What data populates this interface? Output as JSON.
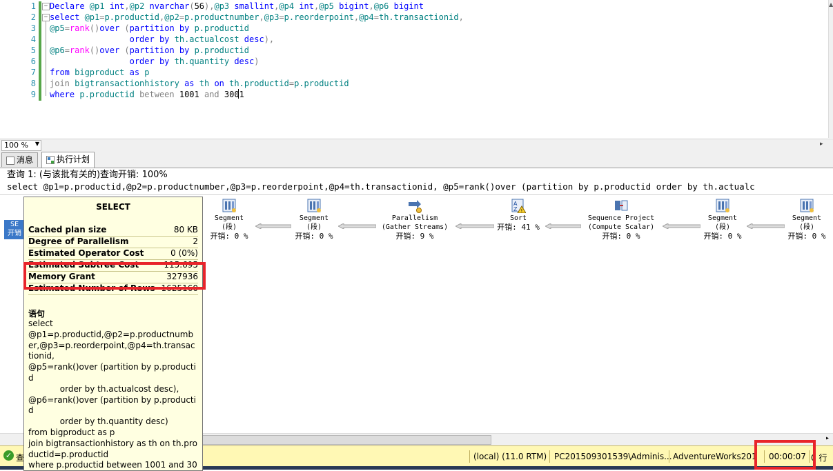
{
  "editor": {
    "line_numbers": [
      "1",
      "2",
      "3",
      "4",
      "5",
      "6",
      "7",
      "8",
      "9"
    ],
    "lines": [
      [
        {
          "c": "kw",
          "t": "Declare "
        },
        {
          "c": "tx",
          "t": "@p1 "
        },
        {
          "c": "kw",
          "t": "int"
        },
        {
          "c": "gr",
          "t": ","
        },
        {
          "c": "tx",
          "t": "@p2 "
        },
        {
          "c": "kw",
          "t": "nvarchar"
        },
        {
          "c": "gr",
          "t": "("
        },
        {
          "c": "",
          "t": "56"
        },
        {
          "c": "gr",
          "t": "),"
        },
        {
          "c": "tx",
          "t": "@p3 "
        },
        {
          "c": "kw",
          "t": "smallint"
        },
        {
          "c": "gr",
          "t": ","
        },
        {
          "c": "tx",
          "t": "@p4 "
        },
        {
          "c": "kw",
          "t": "int"
        },
        {
          "c": "gr",
          "t": ","
        },
        {
          "c": "tx",
          "t": "@p5 "
        },
        {
          "c": "kw",
          "t": "bigint"
        },
        {
          "c": "gr",
          "t": ","
        },
        {
          "c": "tx",
          "t": "@p6 "
        },
        {
          "c": "kw",
          "t": "bigint"
        }
      ],
      [
        {
          "c": "kw",
          "t": "select "
        },
        {
          "c": "tx",
          "t": "@p1"
        },
        {
          "c": "gr",
          "t": "="
        },
        {
          "c": "tx",
          "t": "p.productid"
        },
        {
          "c": "gr",
          "t": ","
        },
        {
          "c": "tx",
          "t": "@p2"
        },
        {
          "c": "gr",
          "t": "="
        },
        {
          "c": "tx",
          "t": "p.productnumber"
        },
        {
          "c": "gr",
          "t": ","
        },
        {
          "c": "tx",
          "t": "@p3"
        },
        {
          "c": "gr",
          "t": "="
        },
        {
          "c": "tx",
          "t": "p.reorderpoint"
        },
        {
          "c": "gr",
          "t": ","
        },
        {
          "c": "tx",
          "t": "@p4"
        },
        {
          "c": "gr",
          "t": "="
        },
        {
          "c": "tx",
          "t": "th.transactionid"
        },
        {
          "c": "gr",
          "t": ","
        }
      ],
      [
        {
          "c": "tx",
          "t": "@p5"
        },
        {
          "c": "gr",
          "t": "="
        },
        {
          "c": "fn",
          "t": "rank"
        },
        {
          "c": "gr",
          "t": "()"
        },
        {
          "c": "kw",
          "t": "over "
        },
        {
          "c": "gr",
          "t": "("
        },
        {
          "c": "kw",
          "t": "partition by "
        },
        {
          "c": "tx",
          "t": "p.productid"
        }
      ],
      [
        {
          "c": "",
          "t": "                "
        },
        {
          "c": "kw",
          "t": "order by "
        },
        {
          "c": "tx",
          "t": "th.actualcost "
        },
        {
          "c": "kw",
          "t": "desc"
        },
        {
          "c": "gr",
          "t": "),"
        }
      ],
      [
        {
          "c": "tx",
          "t": "@p6"
        },
        {
          "c": "gr",
          "t": "="
        },
        {
          "c": "fn",
          "t": "rank"
        },
        {
          "c": "gr",
          "t": "()"
        },
        {
          "c": "kw",
          "t": "over "
        },
        {
          "c": "gr",
          "t": "("
        },
        {
          "c": "kw",
          "t": "partition by "
        },
        {
          "c": "tx",
          "t": "p.productid"
        }
      ],
      [
        {
          "c": "",
          "t": "                "
        },
        {
          "c": "kw",
          "t": "order by "
        },
        {
          "c": "tx",
          "t": "th.quantity "
        },
        {
          "c": "kw",
          "t": "desc"
        },
        {
          "c": "gr",
          "t": ")"
        }
      ],
      [
        {
          "c": "kw",
          "t": "from "
        },
        {
          "c": "tx",
          "t": "bigproduct "
        },
        {
          "c": "kw",
          "t": "as "
        },
        {
          "c": "tx",
          "t": "p"
        }
      ],
      [
        {
          "c": "gr",
          "t": "join "
        },
        {
          "c": "tx",
          "t": "bigtransactionhistory "
        },
        {
          "c": "kw",
          "t": "as "
        },
        {
          "c": "tx",
          "t": "th "
        },
        {
          "c": "kw",
          "t": "on "
        },
        {
          "c": "tx",
          "t": "th.productid"
        },
        {
          "c": "gr",
          "t": "="
        },
        {
          "c": "tx",
          "t": "p.productid"
        }
      ],
      [
        {
          "c": "kw",
          "t": "where "
        },
        {
          "c": "tx",
          "t": "p.productid "
        },
        {
          "c": "gr",
          "t": "between "
        },
        {
          "c": "",
          "t": "1001 "
        },
        {
          "c": "gr",
          "t": "and "
        },
        {
          "c": "",
          "t": "3001"
        }
      ]
    ]
  },
  "zoom": {
    "value": "100 %"
  },
  "tabs": [
    {
      "label": "消息"
    },
    {
      "label": "执行计划"
    }
  ],
  "query": {
    "header": "查询 1: (与该批有关的)查询开销: 100%",
    "sql": "select @p1=p.productid,@p2=p.productnumber,@p3=p.reorderpoint,@p4=th.transactionid, @p5=rank()over (partition by p.productid order by th.actualc"
  },
  "plan": {
    "root": {
      "label": "SE",
      "cost": "开销"
    },
    "nodes": [
      {
        "name": "Segment",
        "sub": "(段)",
        "cost": "开销: 0 %",
        "icon": "segment-icon"
      },
      {
        "name": "Segment",
        "sub": "(段)",
        "cost": "开销: 0 %",
        "icon": "segment-icon"
      },
      {
        "name": "Parallelism",
        "sub": "(Gather Streams)",
        "cost": "开销: 9 %",
        "icon": "parallelism-icon"
      },
      {
        "name": "Sort",
        "sub": "",
        "cost": "开销: 41 %",
        "icon": "sort-warning-icon"
      },
      {
        "name": "Sequence Project",
        "sub": "(Compute Scalar)",
        "cost": "开销: 0 %",
        "icon": "sequence-project-icon"
      },
      {
        "name": "Segment",
        "sub": "(段)",
        "cost": "开销: 0 %",
        "icon": "segment-icon"
      },
      {
        "name": "Segment",
        "sub": "(段)",
        "cost": "开销: 0 %",
        "icon": "segment-icon"
      }
    ]
  },
  "tooltip": {
    "title": "SELECT",
    "rows": [
      {
        "k": "Cached plan size",
        "v": "80 KB"
      },
      {
        "k": "Degree of Parallelism",
        "v": "2"
      },
      {
        "k": "Estimated Operator Cost",
        "v": "0 (0%)"
      },
      {
        "k": "Estimated Subtree Cost",
        "v": "115.695"
      },
      {
        "k": "Memory Grant",
        "v": "327936"
      },
      {
        "k": "Estimated Number of Rows",
        "v": "1625160"
      }
    ],
    "stmt_label": "语句",
    "stmt": "select\n@p1=p.productid,@p2=p.productnumber,@p3=p.reorderpoint,@p4=th.transactionid,\n@p5=rank()over (partition by p.productid\n            order by th.actualcost desc),\n@p6=rank()over (partition by p.productid\n            order by th.quantity desc)\nfrom bigproduct as p\njoin bigtransactionhistory as th on th.productid=p.productid\nwhere p.productid between 1001 and 3001"
  },
  "status": {
    "ok_text": "查",
    "server": "(local) (11.0 RTM)",
    "user": "PC201509301539\\Adminis...",
    "database": "AdventureWorks201",
    "elapsed": "00:00:07",
    "rows": "0 行"
  },
  "colors": {
    "highlight": "#e8242a",
    "status_bg": "#fff8b4",
    "tooltip_bg": "#ffffe1"
  }
}
